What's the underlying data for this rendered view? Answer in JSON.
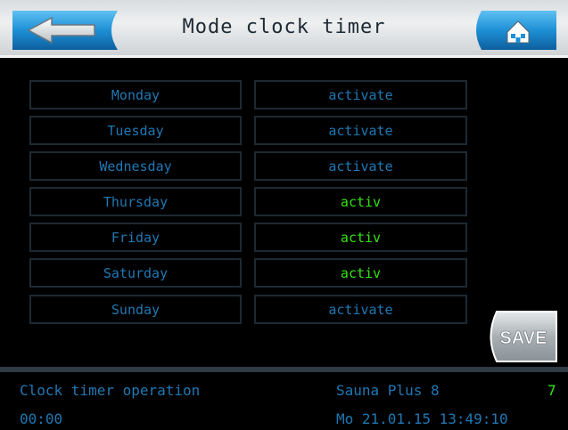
{
  "header": {
    "title": "Mode clock timer",
    "back_icon": "arrow-left-icon",
    "home_icon": "home-icon"
  },
  "days": [
    {
      "day": "Monday",
      "status": "activate",
      "active": false
    },
    {
      "day": "Tuesday",
      "status": "activate",
      "active": false
    },
    {
      "day": "Wednesday",
      "status": "activate",
      "active": false
    },
    {
      "day": "Thursday",
      "status": "activ",
      "active": true
    },
    {
      "day": "Friday",
      "status": "activ",
      "active": true
    },
    {
      "day": "Saturday",
      "status": "activ",
      "active": true
    },
    {
      "day": "Sunday",
      "status": "activate",
      "active": false
    }
  ],
  "save_label": "SAVE",
  "footer": {
    "mode": "Clock timer operation",
    "device": "Sauna Plus 8",
    "level": "7",
    "time_left": "00:00",
    "datetime": "Mo 21.01.15 13:49:10"
  },
  "colors": {
    "text_blue": "#1f78b4",
    "text_green": "#35e312",
    "cell_border": "#1d2a33",
    "header_bg": "#e3e6e8",
    "button_blue": "#1a84c8"
  }
}
